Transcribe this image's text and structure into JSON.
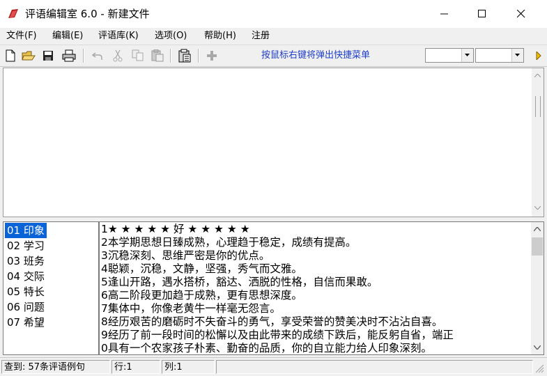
{
  "window": {
    "title": "评语编辑室 6.0 - 新建文件",
    "icons": {
      "app": "app-logo-icon",
      "minimize": "minimize-icon",
      "maximize": "maximize-icon",
      "close": "close-icon"
    }
  },
  "menubar": {
    "items": [
      "文件(F)",
      "编辑(E)",
      "评语库(K)",
      "选项(O)",
      "帮助(H)",
      "注册"
    ]
  },
  "toolbar": {
    "buttons": [
      "new-file-icon",
      "open-folder-icon",
      "save-icon",
      "print-icon",
      "undo-icon",
      "cut-icon",
      "copy-icon",
      "paste-icon",
      "clipboard-notes-icon",
      "add-plus-icon"
    ],
    "hint": "按鼠标右键将弹出快捷菜单",
    "combo1_value": "",
    "combo2_value": ""
  },
  "editor": {
    "content": ""
  },
  "categories": [
    "01 印象",
    "02 学习",
    "03 班务",
    "04 交际",
    "05 特长",
    "06 问题",
    "07 希望"
  ],
  "selected_category": "01 印象",
  "comments": [
    "1★ ★ ★ ★ ★  好  ★ ★ ★ ★ ★",
    "2本学期思想日臻成熟，心理趋于稳定，成绩有提高。",
    "3沉稳深刻、思维严密是你的优点。",
    "4聪颖，沉稳，文静，坚强，秀气而文雅。",
    "5逢山开路，遇水搭桥，豁达、洒脱的性格，自信而果敢。",
    "6高二阶段更加趋于成熟，更有思想深度。",
    "7集体中，你像老黄牛一样毫无怨言。",
    "8经历艰苦的磨砺时不失奋斗的勇气，享受荣誉的赞美决时不沾沾自喜。",
    "9经历了前一段时间的松懈以及由此带来的成绩下跌后，能反躬自省，端正",
    "0具有一个农家孩子朴素、勤奋的品质，你的自立能力给人印象深刻。"
  ],
  "statusbar": {
    "found": "查到: 57条评语例句",
    "row": "行:1",
    "col": "列:1"
  }
}
